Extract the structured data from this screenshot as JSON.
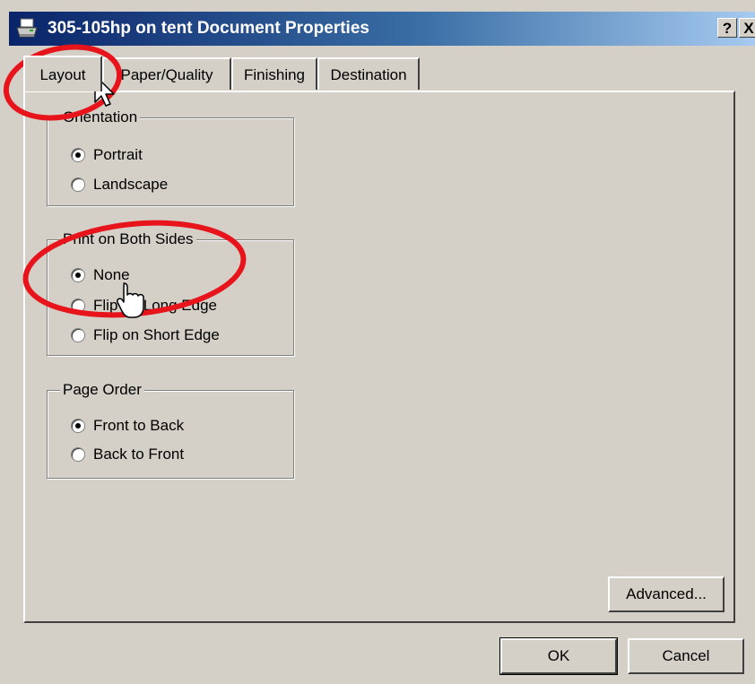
{
  "window": {
    "title": "305-105hp on tent Document Properties",
    "help_label": "?",
    "close_label": "X"
  },
  "tabs": [
    {
      "label": "Layout",
      "active": true
    },
    {
      "label": "Paper/Quality"
    },
    {
      "label": "Finishing"
    },
    {
      "label": "Destination"
    }
  ],
  "orientation": {
    "label": "Orientation",
    "options": [
      {
        "label": "Portrait",
        "checked": true
      },
      {
        "label": "Landscape"
      }
    ]
  },
  "duplex": {
    "label": "Print on Both Sides",
    "options": [
      {
        "label": "None",
        "checked": true
      },
      {
        "label": "Flip on Long Edge"
      },
      {
        "label": "Flip on Short Edge"
      }
    ]
  },
  "page_order": {
    "label": "Page Order",
    "options": [
      {
        "label": "Front to Back",
        "checked": true
      },
      {
        "label": "Back to Front"
      }
    ]
  },
  "buttons": {
    "advanced": "Advanced...",
    "ok": "OK",
    "cancel": "Cancel"
  },
  "icons": {
    "title": "printer-icon",
    "cursor_arrow": "arrow-cursor-icon",
    "cursor_hand": "hand-cursor-icon"
  },
  "colors": {
    "titlebar_start": "#0a246a",
    "titlebar_end": "#a6caf0",
    "face": "#d4d0c8",
    "annotation": "#e8141c"
  }
}
